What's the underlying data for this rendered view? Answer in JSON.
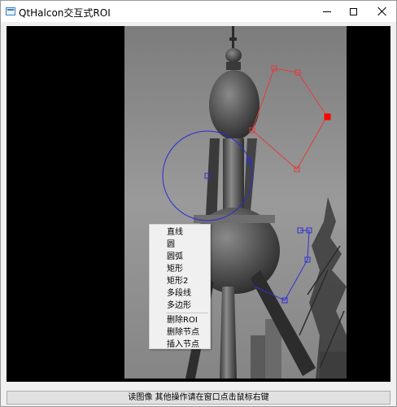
{
  "window": {
    "title": "QtHalcon交互式ROI",
    "app_icon": "window-app-icon"
  },
  "titlebar_buttons": {
    "minimize_icon": "minimize-icon",
    "maximize_icon": "maximize-icon",
    "close_icon": "close-icon"
  },
  "context_menu": {
    "items": [
      "直线",
      "圆",
      "圆弧",
      "矩形",
      "矩形2",
      "多段线",
      "多边形"
    ],
    "items2": [
      "删除ROI",
      "删除节点",
      "插入节点"
    ]
  },
  "status": {
    "text": "读图像  其他操作请在窗口点击鼠标右键"
  },
  "colors": {
    "polygon_roi": "#e43b3b",
    "circle_roi": "#2b2bd6",
    "polyline_roi": "#3030d6",
    "active_handle": "#ff0000"
  }
}
